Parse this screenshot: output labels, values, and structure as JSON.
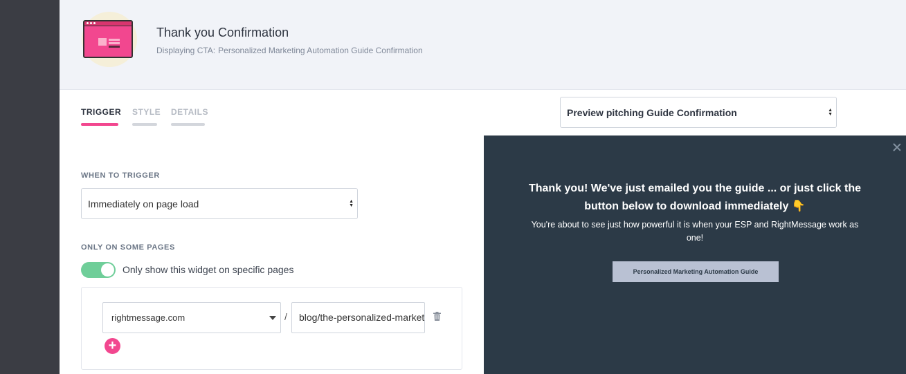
{
  "header": {
    "title": "Thank you Confirmation",
    "subtitle_prefix": "Displaying CTA:",
    "subtitle_cta": "Personalized Marketing Automation Guide Confirmation"
  },
  "tabs": [
    {
      "label": "TRIGGER",
      "active": true
    },
    {
      "label": "STYLE",
      "active": false
    },
    {
      "label": "DETAILS",
      "active": false
    }
  ],
  "trigger": {
    "when_label": "WHEN TO TRIGGER",
    "when_value": "Immediately on page load",
    "pages_label": "ONLY ON SOME PAGES",
    "toggle_on": true,
    "toggle_label": "Only show this widget on specific pages",
    "domain_value": "rightmessage.com",
    "separator": "/",
    "path_value": "blog/the-personalized-marketing-automation-guide",
    "add_label": "+"
  },
  "preview": {
    "select_value": "Preview pitching Guide Confirmation",
    "heading": "Thank you! We've just emailed you the guide ... or just click the button below to download immediately 👇",
    "body": "You're about to see just how powerful it is when your ESP and RightMessage work as one!",
    "button_label": "Personalized Marketing Automation Guide"
  },
  "colors": {
    "accent": "#f2478f",
    "toggle_on": "#6fce99",
    "preview_bg": "#2c3a47",
    "sidebar": "#3b3d44"
  }
}
